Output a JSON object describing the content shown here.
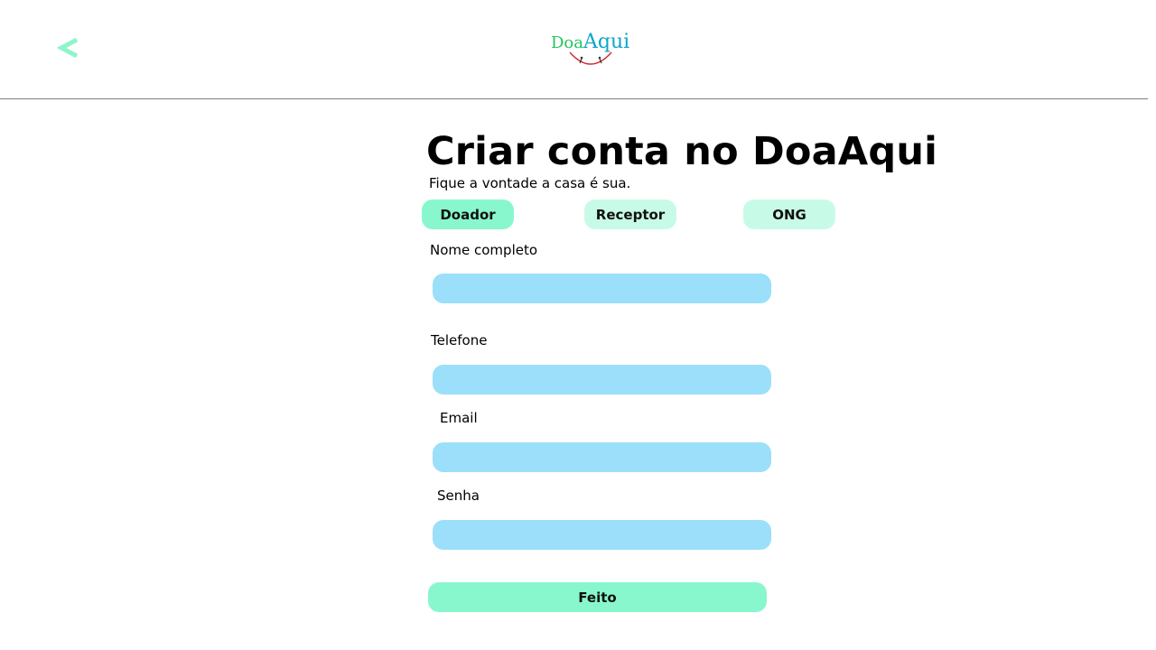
{
  "header": {
    "back_icon": "chevron-left-icon",
    "logo": {
      "part1": "Doa",
      "part2": "Aqui"
    }
  },
  "main": {
    "title": "Criar conta no DoaAqui",
    "subtitle": "Fique a vontade a casa é sua.",
    "tabs": [
      {
        "label": "Doador",
        "active": true
      },
      {
        "label": "Receptor",
        "active": false
      },
      {
        "label": "ONG",
        "active": false
      }
    ],
    "fields": {
      "name": {
        "label": "Nome completo",
        "value": ""
      },
      "phone": {
        "label": "Telefone",
        "value": ""
      },
      "email": {
        "label": "Email",
        "value": ""
      },
      "password": {
        "label": "Senha",
        "value": ""
      }
    },
    "submit_label": "Feito"
  },
  "colors": {
    "accent_green": "#88f7cd",
    "accent_green_light": "#c8fbe7",
    "input_blue": "#9bdffa",
    "logo_green": "#22c55e",
    "logo_blue": "#0ea5c9",
    "back_arrow": "#8ef5c8"
  }
}
